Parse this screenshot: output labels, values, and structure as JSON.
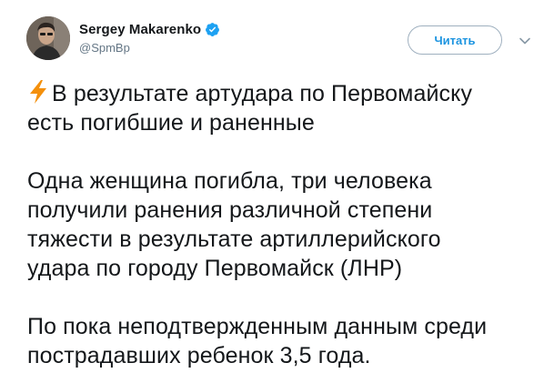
{
  "author": {
    "display_name": "Sergey Makarenko",
    "handle": "@SpmBp",
    "verified": true,
    "verified_color": "#1da1f2"
  },
  "actions": {
    "follow_label": "Читать"
  },
  "icons": {
    "verified": "verified-badge-icon",
    "lightning": "high-voltage-emoji-icon",
    "more": "chevron-down-icon"
  },
  "tweet": {
    "paragraphs": [
      {
        "lines": [
          "В результате артудара по Первомайску",
          "есть погибшие и раненные"
        ]
      },
      {
        "lines": [
          "Одна женщина погибла, три человека",
          "получили ранения различной степени",
          "тяжести в результате артиллерийского",
          "удара по городу Первомайск (ЛНР)"
        ]
      },
      {
        "lines": [
          "По пока неподтвержденным данным среди",
          "пострадавших ребенок 3,5 года."
        ]
      }
    ]
  },
  "colors": {
    "text": "#14171a",
    "secondary_text": "#657786",
    "button_text": "#1c94e0",
    "lightning": "#f4900c"
  }
}
